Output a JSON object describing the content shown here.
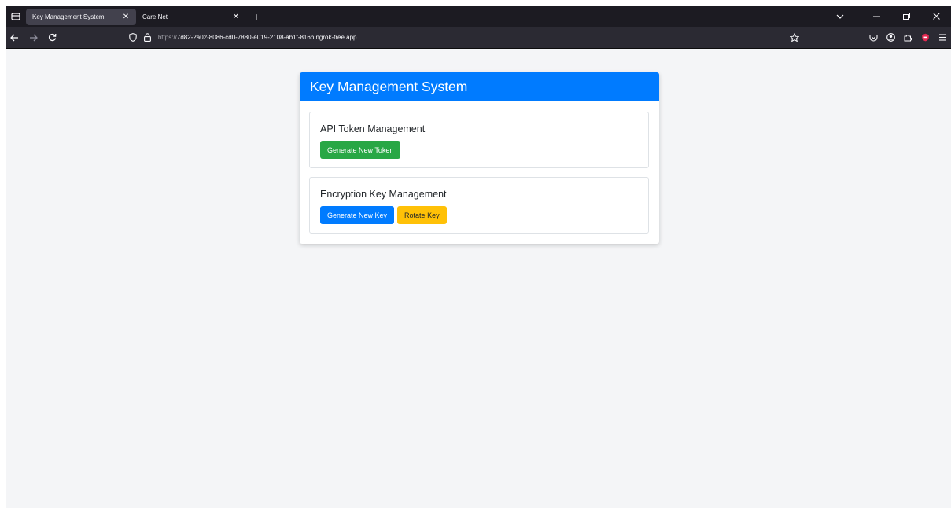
{
  "browser": {
    "tabs": [
      {
        "label": "Key Management System",
        "active": true
      },
      {
        "label": "Care Net",
        "active": false
      }
    ],
    "url": {
      "scheme": "https://",
      "host": "7d82-2a02-8086-cd0-7880-e019-2108-ab1f-816b.ngrok-free.app"
    },
    "icons": {
      "tab_menu": "tab-menu-icon",
      "new_tab": "plus-icon",
      "list_all_tabs": "chevron-down-icon",
      "minimize": "minimize-icon",
      "restore": "restore-icon",
      "close": "close-icon",
      "back": "back-arrow-icon",
      "forward": "forward-arrow-icon",
      "reload": "reload-icon",
      "shield": "shield-icon",
      "lock": "lock-icon",
      "bookmark": "star-icon",
      "pocket": "pocket-icon",
      "account": "account-icon",
      "extensions": "extensions-icon",
      "ublock": "ublock-icon",
      "menu": "hamburger-menu-icon"
    },
    "colors": {
      "tabstrip_bg": "#1c1b22",
      "active_tab_bg": "#42414d",
      "navbar_bg": "#2b2a33"
    }
  },
  "app": {
    "title": "Key Management System",
    "sections": [
      {
        "title": "API Token Management",
        "buttons": [
          {
            "label": "Generate New Token",
            "variant": "success"
          }
        ]
      },
      {
        "title": "Encryption Key Management",
        "buttons": [
          {
            "label": "Generate New Key",
            "variant": "primary"
          },
          {
            "label": "Rotate Key",
            "variant": "warning"
          }
        ]
      }
    ],
    "colors": {
      "primary": "#007bff",
      "success": "#28a745",
      "warning": "#ffc107",
      "page_bg": "#f4f5f7"
    }
  }
}
